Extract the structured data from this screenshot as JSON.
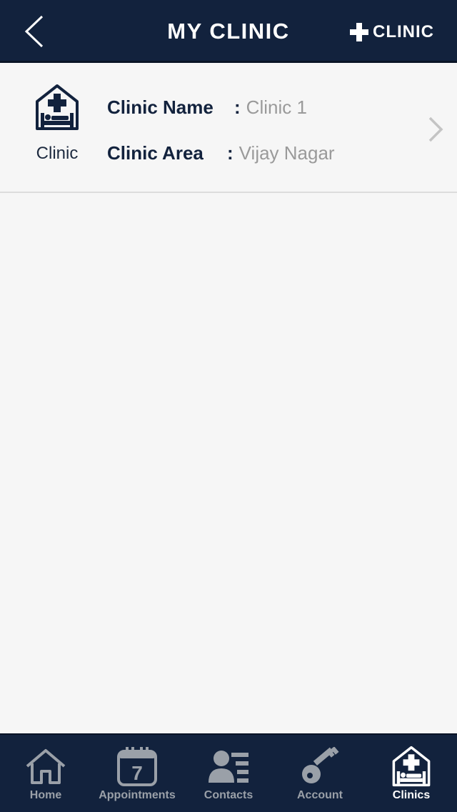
{
  "header": {
    "title": "MY CLINIC",
    "back_icon": "chevron-left-icon",
    "add_label": "CLINIC",
    "add_icon": "plus-icon"
  },
  "clinics": [
    {
      "icon": "clinic-bed-icon",
      "caption": "Clinic",
      "name_label": "Clinic Name",
      "name_value": "Clinic 1",
      "area_label": "Clinic Area",
      "area_value": "Vijay Nagar",
      "separator": ":"
    }
  ],
  "tabs": [
    {
      "label": "Home",
      "icon": "home-icon",
      "active": false
    },
    {
      "label": "Appointments",
      "icon": "calendar-icon",
      "day": "7",
      "active": false
    },
    {
      "label": "Contacts",
      "icon": "contacts-icon",
      "active": false
    },
    {
      "label": "Account",
      "icon": "key-icon",
      "active": false
    },
    {
      "label": "Clinics",
      "icon": "clinic-bed-icon",
      "active": true
    }
  ],
  "colors": {
    "header_bg": "#12223d",
    "background": "#f6f6f6",
    "label_text": "#12223d",
    "value_text": "#9a9a9a",
    "tab_inactive": "#9aa0a8",
    "tab_active": "#ffffff"
  }
}
